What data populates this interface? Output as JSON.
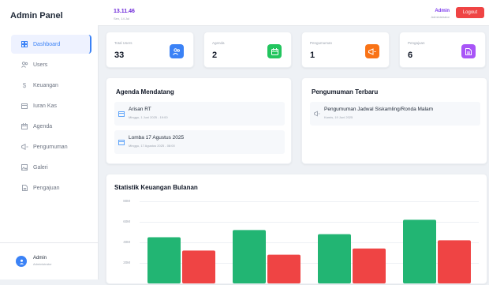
{
  "app": {
    "title": "Admin Panel"
  },
  "sidebar": {
    "items": [
      {
        "label": "Dashboard",
        "icon": "dashboard-icon",
        "active": true
      },
      {
        "label": "Users",
        "icon": "users-icon",
        "active": false
      },
      {
        "label": "Keuangan",
        "icon": "dollar-icon",
        "active": false
      },
      {
        "label": "Iuran Kas",
        "icon": "cash-box-icon",
        "active": false
      },
      {
        "label": "Agenda",
        "icon": "calendar-icon",
        "active": false
      },
      {
        "label": "Pengumuman",
        "icon": "megaphone-icon",
        "active": false
      },
      {
        "label": "Galeri",
        "icon": "image-icon",
        "active": false
      },
      {
        "label": "Pengajuan",
        "icon": "document-icon",
        "active": false
      }
    ],
    "user": {
      "name": "Admin",
      "role": "Administrator"
    }
  },
  "header": {
    "time": "13.11.46",
    "date": "Sen, 14 Jul",
    "user_name": "Admin",
    "user_role": "Administrator",
    "logout_label": "Logout"
  },
  "stats": [
    {
      "label": "Total Users",
      "value": "33",
      "color": "#3b82f6",
      "icon": "users-icon"
    },
    {
      "label": "Agenda",
      "value": "2",
      "color": "#22c55e",
      "icon": "calendar-icon"
    },
    {
      "label": "Pengumuman",
      "value": "1",
      "color": "#f97316",
      "icon": "megaphone-icon"
    },
    {
      "label": "Pengajuan",
      "value": "6",
      "color": "#a855f7",
      "icon": "document-icon"
    }
  ],
  "agenda": {
    "title": "Agenda Mendatang",
    "items": [
      {
        "title": "Arisan RT",
        "date": "Minggu, 1 Juni 2025 - 19:00"
      },
      {
        "title": "Lomba 17 Agustus 2025",
        "date": "Minggu, 17 Agustus 2025 - 08:00"
      }
    ]
  },
  "announcements": {
    "title": "Pengumuman Terbaru",
    "items": [
      {
        "title": "Pengumuman Jadwal Siskamling/Ronda Malam",
        "date": "Kamis, 19 Juni 2025"
      }
    ]
  },
  "chart_data": {
    "type": "bar",
    "title": "Statistik Keuangan Bulanan",
    "yticks": [
      "80M",
      "60M",
      "40M",
      "20M"
    ],
    "ylim": [
      0,
      80
    ],
    "series": [
      {
        "color": "#22b573",
        "values": [
          45,
          52,
          48,
          62
        ]
      },
      {
        "color": "#ef4444",
        "values": [
          32,
          28,
          34,
          42
        ]
      }
    ]
  }
}
